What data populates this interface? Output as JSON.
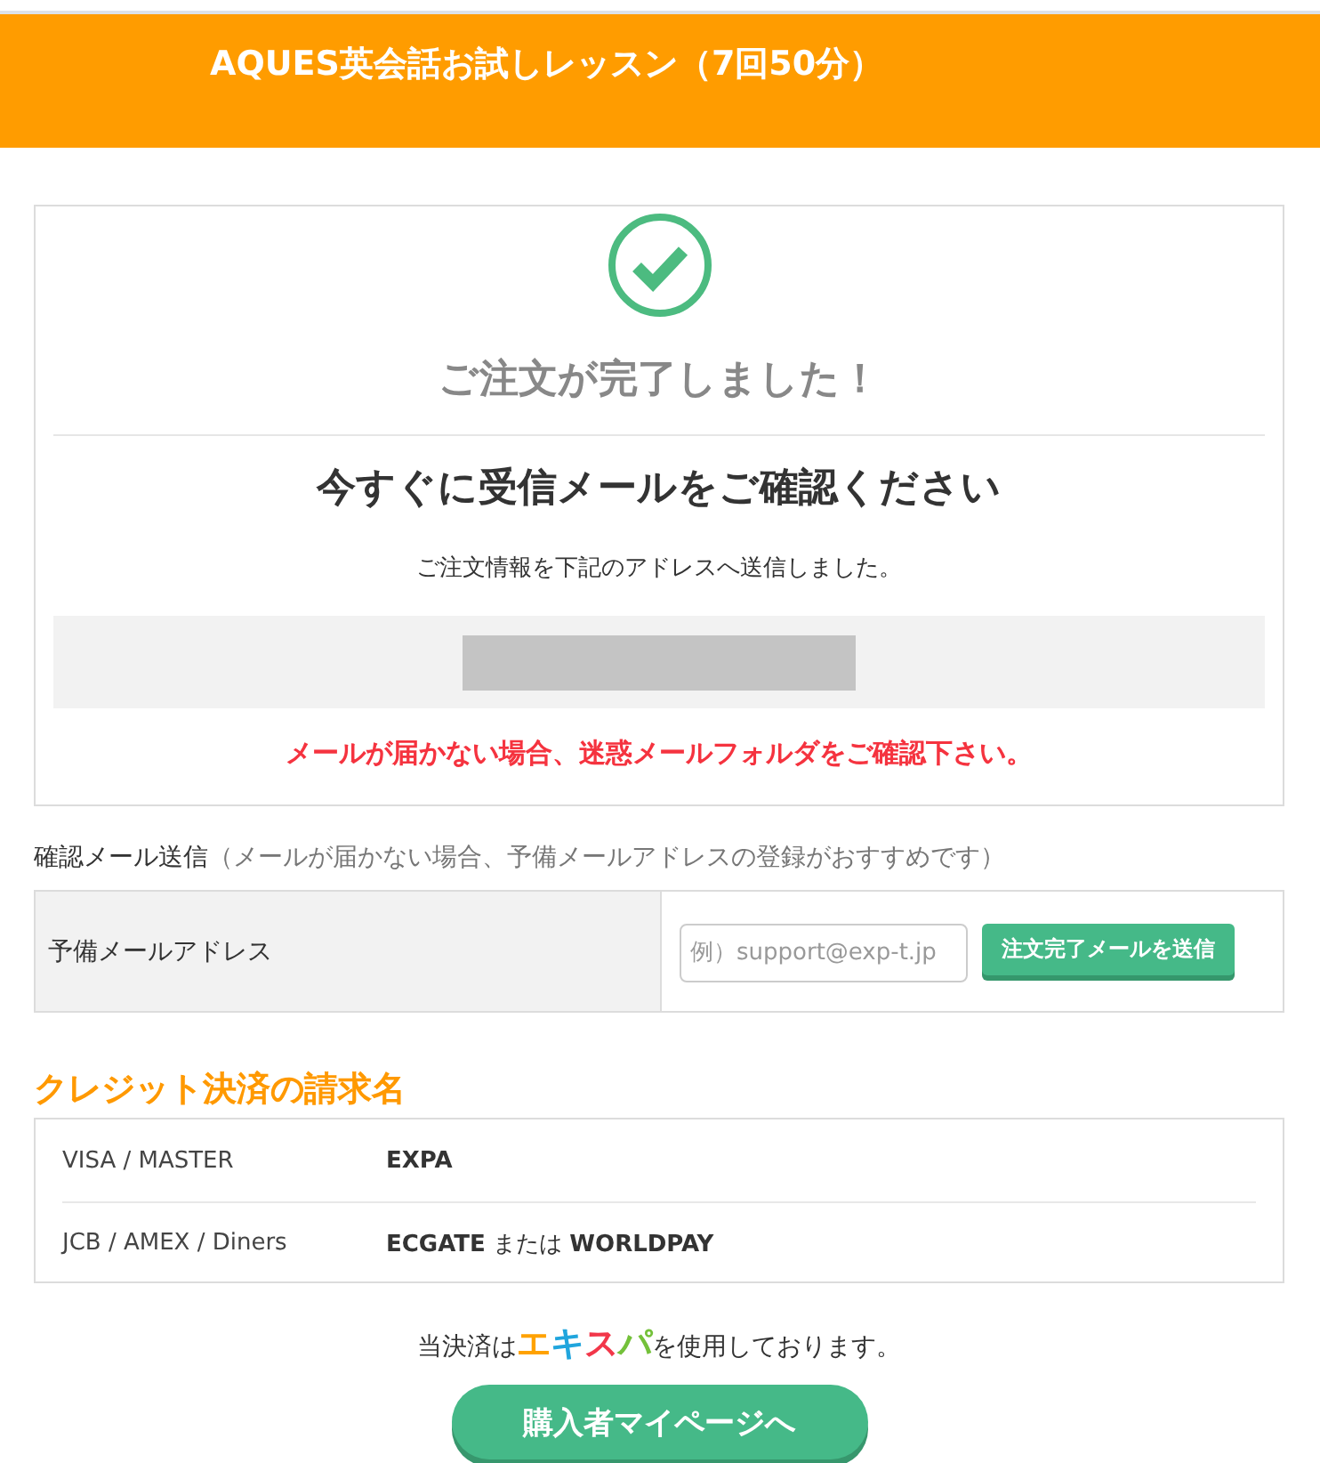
{
  "header": {
    "title": "AQUES英会話お試しレッスン（7回50分）"
  },
  "confirmation": {
    "title": "ご注文が完了しました！",
    "heading": "今すぐに受信メールをご確認ください",
    "message": "ご注文情報を下記のアドレスへ送信しました。",
    "warning": "メールが届かない場合、迷惑メールフォルダをご確認下さい。"
  },
  "backup_email": {
    "label": "確認メール送信",
    "hint": "（メールが届かない場合、予備メールアドレスの登録がおすすめです）",
    "field_label": "予備メールアドレス",
    "placeholder": "例）support@exp-t.jp",
    "button": "注文完了メールを送信"
  },
  "billing": {
    "title": "クレジット決済の請求名",
    "rows": [
      {
        "cards": "VISA / MASTER",
        "name": "**EXPA**"
      },
      {
        "cards": "JCB / AMEX / Diners",
        "name": "**ECGATE** または **WORLDPAY**"
      }
    ]
  },
  "footer": {
    "note_before": "当決済は",
    "brand": [
      {
        "text": "エ",
        "color": "#ffa200"
      },
      {
        "text": "キ",
        "color": "#20a5dd"
      },
      {
        "text": "ス",
        "color": "#f2374a"
      },
      {
        "text": "パ",
        "color": "#74c13a"
      }
    ],
    "note_after": "を使用しております。",
    "button": "購入者マイページへ"
  }
}
